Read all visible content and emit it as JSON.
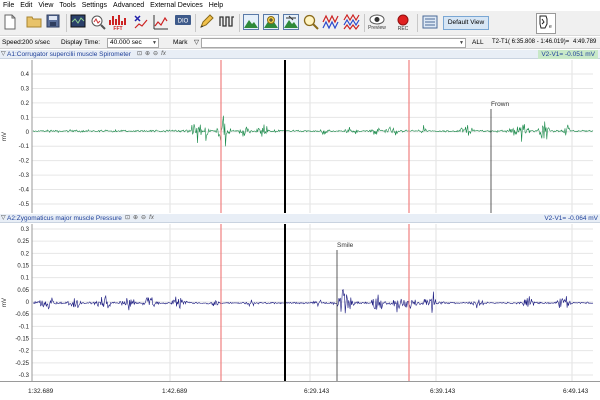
{
  "menu": [
    "File",
    "Edit",
    "View",
    "Tools",
    "Settings",
    "Advanced",
    "External Devices",
    "Help"
  ],
  "toolbar": {
    "fft_label": "FFT",
    "preview_label": "Preview",
    "rec_label": "REC",
    "default_view_label": "Default View",
    "icons": [
      "new-file-icon",
      "open-folder-icon",
      "save-icon",
      "report-icon",
      "scope-icon",
      "zoom-analysis-icon",
      "fft-icon",
      "xy-icon",
      "graph-icon",
      "channel-icon",
      "marker-pen-icon",
      "pulse-icon",
      "mountain-icon",
      "mountain-plus-icon",
      "mountain-zoom-icon",
      "magnify-icon",
      "wave-double-icon",
      "wave-triple-icon",
      "preview-icon",
      "record-icon",
      "view-layout-icon",
      "device-logo-icon"
    ]
  },
  "controls": {
    "speed_label": "Speed:",
    "speed_value": "200 s/sec",
    "display_time_label": "Display Time:",
    "display_time_value": "40.000 sec",
    "mark_label": "Mark",
    "all_label": "ALL",
    "t2t1_label": "T2-T1( 6:35.808 - 1:46.019)=",
    "t2t1_value": "4:49.789"
  },
  "channel1": {
    "name": "A1:Corrugator supercilii muscle",
    "sensor": "Spirometer",
    "v2v1": "V2-V1= -0.051 mV",
    "unit": "mV",
    "annotation": "Frown",
    "y_ticks": [
      "0.4",
      "0.3",
      "0.2",
      "0.1",
      "0",
      "-0.1",
      "-0.2",
      "-0.3",
      "-0.4",
      "-0.5"
    ],
    "color": "#1a8a4a"
  },
  "channel2": {
    "name": "A2:Zygomaticus major muscle",
    "sensor": "Pressure",
    "v2v1": "V2-V1= -0.064 mV",
    "unit": "mV",
    "annotation": "Smile",
    "y_ticks": [
      "0.3",
      "0.25",
      "0.2",
      "0.15",
      "0.1",
      "0.05",
      "0",
      "-0.05",
      "-0.1",
      "-0.15",
      "-0.2",
      "-0.25",
      "-0.3"
    ],
    "color": "#1a1a80"
  },
  "time_axis": {
    "ticks": [
      "1:32.689",
      "1:42.689",
      "6:29.143",
      "6:39.143",
      "6:49.143"
    ]
  },
  "colors": {
    "cursor_red": "#f08080",
    "cursor_black": "#000000",
    "accent_blue": "#1d3f99"
  }
}
